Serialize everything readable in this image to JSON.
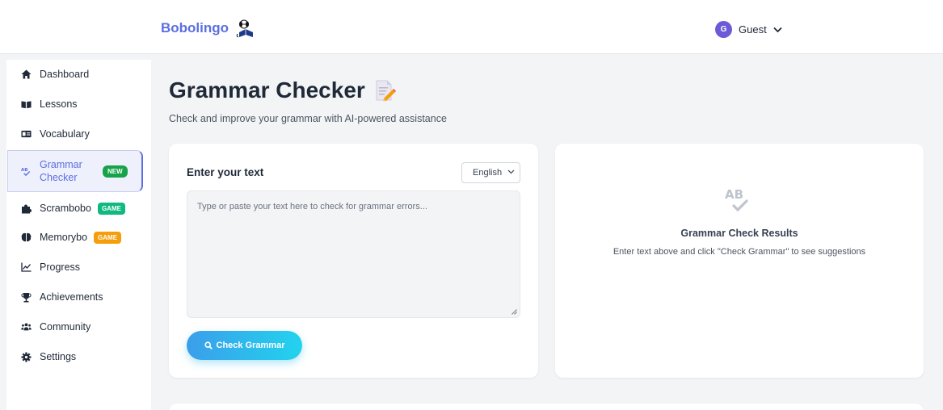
{
  "header": {
    "brand": "Bobolingo",
    "logo_icon": "reading-dog-icon",
    "user": {
      "initial": "G",
      "name": "Guest",
      "chevron_icon": "chevron-down-icon"
    }
  },
  "sidebar": {
    "items": [
      {
        "label": "Dashboard",
        "icon": "home-icon"
      },
      {
        "label": "Lessons",
        "icon": "book-open-icon"
      },
      {
        "label": "Vocabulary",
        "icon": "id-card-icon"
      },
      {
        "label": "Grammar Checker",
        "icon": "spellcheck-icon",
        "badge": "NEW",
        "active": true
      },
      {
        "label": "Scrambobo",
        "icon": "puzzle-icon",
        "badge": "GAME"
      },
      {
        "label": "Memorybo",
        "icon": "brain-icon",
        "badge": "GAME"
      },
      {
        "label": "Progress",
        "icon": "chart-line-icon"
      },
      {
        "label": "Achievements",
        "icon": "trophy-icon"
      },
      {
        "label": "Community",
        "icon": "users-icon"
      },
      {
        "label": "Settings",
        "icon": "gear-icon"
      }
    ]
  },
  "main": {
    "title": "Grammar Checker",
    "title_icon": "memo-pencil-icon",
    "subtitle": "Check and improve your grammar with AI-powered assistance",
    "input_card": {
      "title": "Enter your text",
      "language": "English",
      "placeholder": "Type or paste your text here to check for grammar errors...",
      "button": "Check Grammar",
      "button_icon": "search-icon"
    },
    "results_card": {
      "icon": "spellcheck-icon",
      "title": "Grammar Check Results",
      "text": "Enter text above and click \"Check Grammar\" to see suggestions"
    }
  },
  "colors": {
    "brand": "#5b6ee1",
    "badge_new": "#16a34a",
    "badge_game_green": "#10b981",
    "badge_game_orange": "#f59e0b",
    "avatar": "#6b5bd6",
    "button_gradient": [
      "#3b9eea",
      "#22d3ee"
    ]
  }
}
